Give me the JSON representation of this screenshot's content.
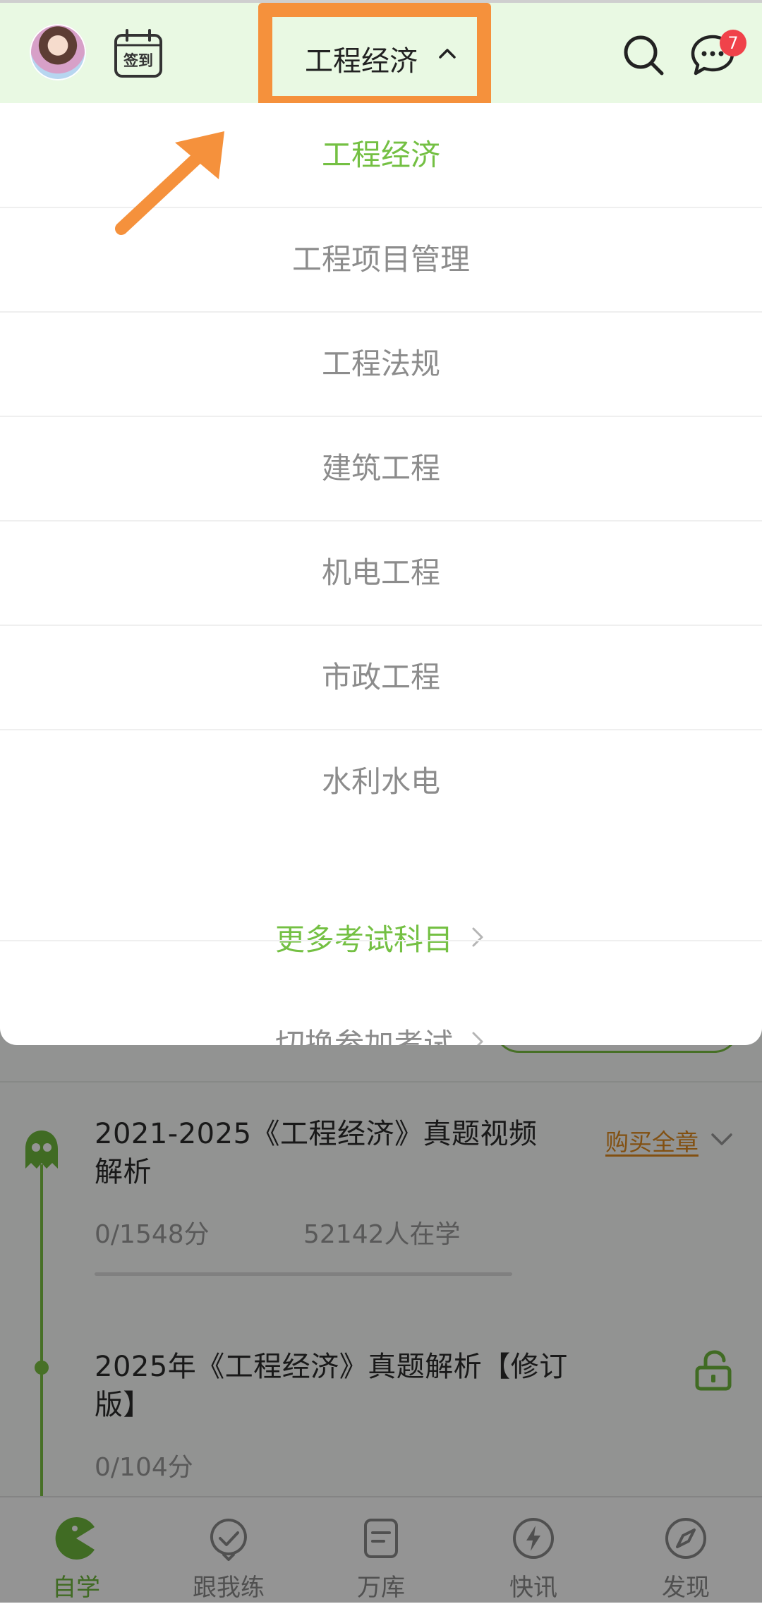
{
  "header": {
    "signin_label": "签到",
    "exam_selector_label": "工程经济",
    "message_badge_count": "7"
  },
  "dropdown": {
    "subjects": [
      {
        "label": "工程经济",
        "selected": true
      },
      {
        "label": "工程项目管理",
        "selected": false
      },
      {
        "label": "工程法规",
        "selected": false
      },
      {
        "label": "建筑工程",
        "selected": false
      },
      {
        "label": "机电工程",
        "selected": false
      },
      {
        "label": "市政工程",
        "selected": false
      },
      {
        "label": "水利水电",
        "selected": false
      }
    ],
    "more_subjects_label": "更多考试科目",
    "switch_exam_label": "切换参加考试"
  },
  "courses": [
    {
      "title": "2021-2025《工程经济》真题视频解析",
      "score": "0/1548分",
      "learners": "52142人在学",
      "action_label": "购买全章"
    },
    {
      "title": "2025年《工程经济》真题解析【修订版】",
      "score": "0/104分"
    }
  ],
  "bottom_nav": [
    {
      "label": "自学",
      "icon": "pacman-icon",
      "active": true
    },
    {
      "label": "跟我练",
      "icon": "check-badge-icon",
      "active": false
    },
    {
      "label": "万库",
      "icon": "document-icon",
      "active": false
    },
    {
      "label": "快讯",
      "icon": "lightning-icon",
      "active": false
    },
    {
      "label": "发现",
      "icon": "compass-icon",
      "active": false
    }
  ],
  "colors": {
    "accent_green": "#74c043",
    "annotation_orange": "#f5913c",
    "badge_red": "#f0424a",
    "header_bg": "#e9f9e3"
  }
}
